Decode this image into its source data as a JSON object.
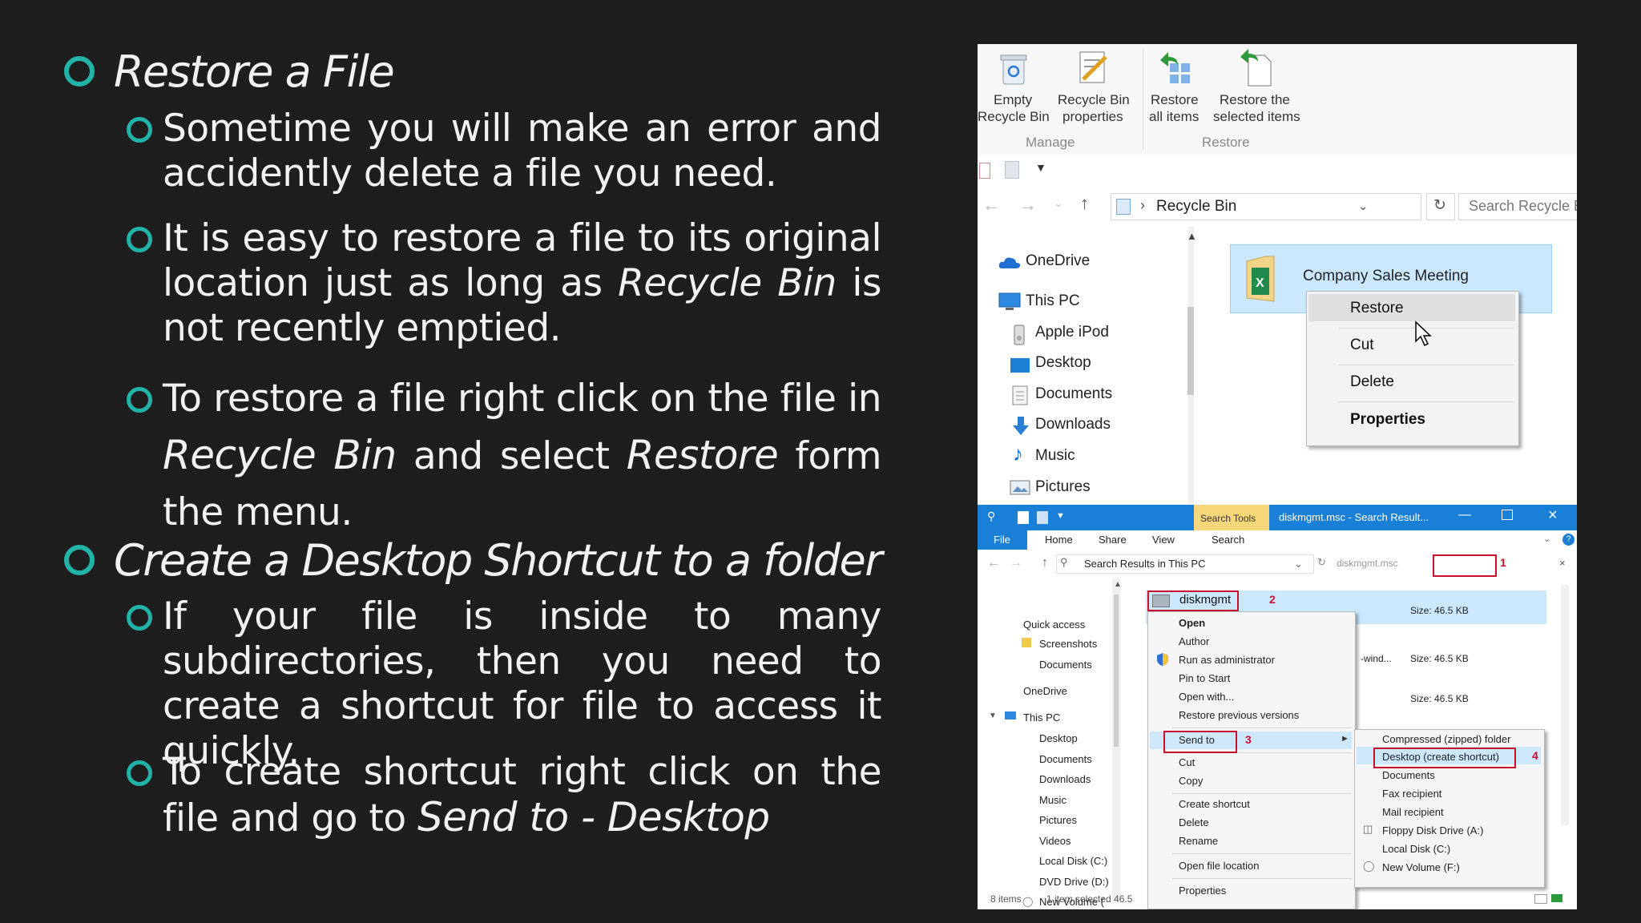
{
  "slide": {
    "heading1": "Restore a File",
    "p1": "Sometime you will make an error and accidently delete a file you need.",
    "p2_a": "It is easy to restore a file to its original location just as long as ",
    "p2_em": "Recycle Bin",
    "p2_b": " is not recently emptied.",
    "p3_a": "To restore a file right click on the file in ",
    "p3_em1": "Recycle Bin",
    "p3_b": " and select ",
    "p3_em2": "Restore",
    "p3_c": " form the menu.",
    "heading2": "Create a Desktop Shortcut to a folder",
    "p4": "If your file is inside to many subdirectories, then you need to create a shortcut for file to access it quickly.",
    "p5_a": "To create shortcut right click on the file and go to ",
    "p5_em": "Send to - Desktop",
    "accent": "#21b3a8",
    "background": "#1e1e1f"
  },
  "recycle": {
    "ribbon": {
      "empty_l1": "Empty",
      "empty_l2": "Recycle Bin",
      "props_l1": "Recycle Bin",
      "props_l2": "properties",
      "restore_all_l1": "Restore",
      "restore_all_l2": "all items",
      "restore_sel_l1": "Restore the",
      "restore_sel_l2": "selected items",
      "group_manage": "Manage",
      "group_restore": "Restore"
    },
    "address": "Recycle Bin",
    "search_placeholder": "Search Recycle Bin",
    "nav": [
      "OneDrive",
      "This PC",
      "Apple iPod",
      "Desktop",
      "Documents",
      "Downloads",
      "Music",
      "Pictures"
    ],
    "file_name": "Company Sales Meeting",
    "context_menu": [
      "Restore",
      "Cut",
      "Delete",
      "Properties"
    ]
  },
  "explorer": {
    "search_tools": "Search Tools",
    "title": "diskmgmt.msc - Search Result...",
    "tabs": [
      "File",
      "Home",
      "Share",
      "View",
      "Search"
    ],
    "address": "Search Results in This PC",
    "search_value": "diskmgmt.msc",
    "nav": [
      "Quick access",
      "Screenshots",
      "Documents",
      "OneDrive",
      "This PC",
      "Desktop",
      "Documents",
      "Downloads",
      "Music",
      "Pictures",
      "Videos",
      "Local Disk (C:)",
      "DVD Drive (D:)",
      "New Volume ("
    ],
    "file_name": "diskmgmt",
    "sizes": [
      "Size: 46.5 KB",
      "Size: 46.5 KB",
      "Size: 46.5 KB"
    ],
    "wind_text": "-wind...",
    "context_menu": [
      "Open",
      "Author",
      "Run as administrator",
      "Pin to Start",
      "Open with...",
      "Restore previous versions",
      "Send to",
      "Cut",
      "Copy",
      "Create shortcut",
      "Delete",
      "Rename",
      "Open file location",
      "Properties"
    ],
    "send_to_menu": [
      "Compressed (zipped) folder",
      "Desktop (create shortcut)",
      "Documents",
      "Fax recipient",
      "Mail recipient",
      "Floppy Disk Drive (A:)",
      "Local Disk (C:)",
      "New Volume (F:)"
    ],
    "status_items": "8 items",
    "status_selected": "1 item selected  46.5",
    "step_numbers": [
      "1",
      "2",
      "3",
      "4"
    ]
  }
}
